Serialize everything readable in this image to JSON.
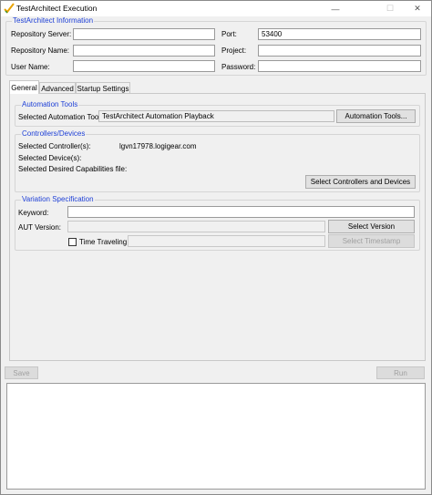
{
  "window": {
    "title": "TestArchitect Execution",
    "controls": [
      "—",
      "☐",
      "✕"
    ]
  },
  "repository": {
    "legend": "TestArchitect Information",
    "server_label": "Repository Server:",
    "server_value": "",
    "port_label": "Port:",
    "port_value": "53400",
    "name_label": "Repository Name:",
    "name_value": "",
    "project_label": "Project:",
    "project_value": "",
    "user_label": "User Name:",
    "user_value": "",
    "password_label": "Password:",
    "password_value": ""
  },
  "tabs": [
    {
      "label": "General",
      "active": true
    },
    {
      "label": "Advanced",
      "active": false
    },
    {
      "label": "Startup Settings",
      "active": false
    }
  ],
  "automation_tools": {
    "legend": "Automation Tools",
    "selected_label": "Selected Automation Tool:",
    "selected_value": "TestArchitect Automation Playback",
    "button": "Automation Tools..."
  },
  "controllers": {
    "legend": "Controllers/Devices",
    "controllers_label": "Selected Controller(s):",
    "controllers_value": "lgvn17978.logigear.com",
    "devices_label": "Selected Device(s):",
    "devices_value": "",
    "capabilities_label": "Selected Desired Capabilities file:",
    "capabilities_value": "",
    "button": "Select Controllers and Devices"
  },
  "variation": {
    "legend": "Variation Specification",
    "keyword_label": "Keyword:",
    "keyword_value": "",
    "aut_label": "AUT Version:",
    "aut_value": "",
    "select_version_button": "Select Version",
    "time_traveling_label": "Time Traveling",
    "time_traveling_checked": false,
    "timestamp_value": "",
    "select_timestamp_button": "Select Timestamp"
  },
  "footer": {
    "save_button": "Save",
    "run_button": "Run",
    "output_text": ""
  },
  "colors": {
    "legend_text": "#1d3fd6",
    "icon_orange": "#e8a200",
    "icon_green": "#3a8f2a"
  }
}
